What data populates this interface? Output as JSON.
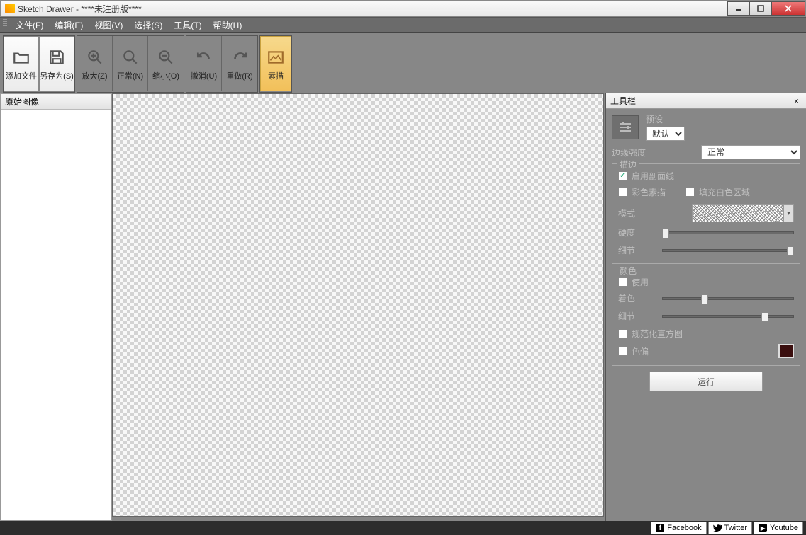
{
  "title": "Sketch Drawer - ****未注册版****",
  "menu": {
    "file": "文件(F)",
    "edit": "编辑(E)",
    "view": "视图(V)",
    "select": "选择(S)",
    "tools": "工具(T)",
    "help": "帮助(H)"
  },
  "toolbar": {
    "add_file": "添加文件",
    "save_as": "另存为(S)",
    "zoom_in": "放大(Z)",
    "normal": "正常(N)",
    "zoom_out": "缩小(O)",
    "undo": "撤消(U)",
    "redo": "重做(R)",
    "sketch": "素描"
  },
  "left_panel": {
    "title": "原始图像"
  },
  "right_panel": {
    "title": "工具栏",
    "preset_label": "预设",
    "preset_value": "默认",
    "edge_strength_label": "边缘强度",
    "edge_strength_value": "正常",
    "stroke_group": "描边",
    "enable_hatch": "启用剖面线",
    "color_sketch": "彩色素描",
    "fill_white": "填充白色区域",
    "pattern_label": "模式",
    "hardness_label": "硬度",
    "detail_label": "细节",
    "color_group": "颜色",
    "use_label": "使用",
    "hue_label": "着色",
    "detail2_label": "细节",
    "normalize_hist": "规范化直方图",
    "color_shift": "色偏",
    "run": "运行",
    "sliders": {
      "hardness_pct": 2,
      "detail_pct": 98,
      "hue_pct": 32,
      "color_detail_pct": 78
    },
    "color_swatch": "#3a0e0e"
  },
  "social": {
    "facebook": "Facebook",
    "twitter": "Twitter",
    "youtube": "Youtube"
  },
  "icons": {
    "folder": "folder-open-icon",
    "save": "save-icon",
    "zoom_in": "zoom-in-icon",
    "zoom_normal": "zoom-normal-icon",
    "zoom_out": "zoom-out-icon",
    "undo": "undo-icon",
    "redo": "redo-icon",
    "sketch": "sketch-icon",
    "sliders": "sliders-icon",
    "dropdown": "chevron-down-icon"
  }
}
